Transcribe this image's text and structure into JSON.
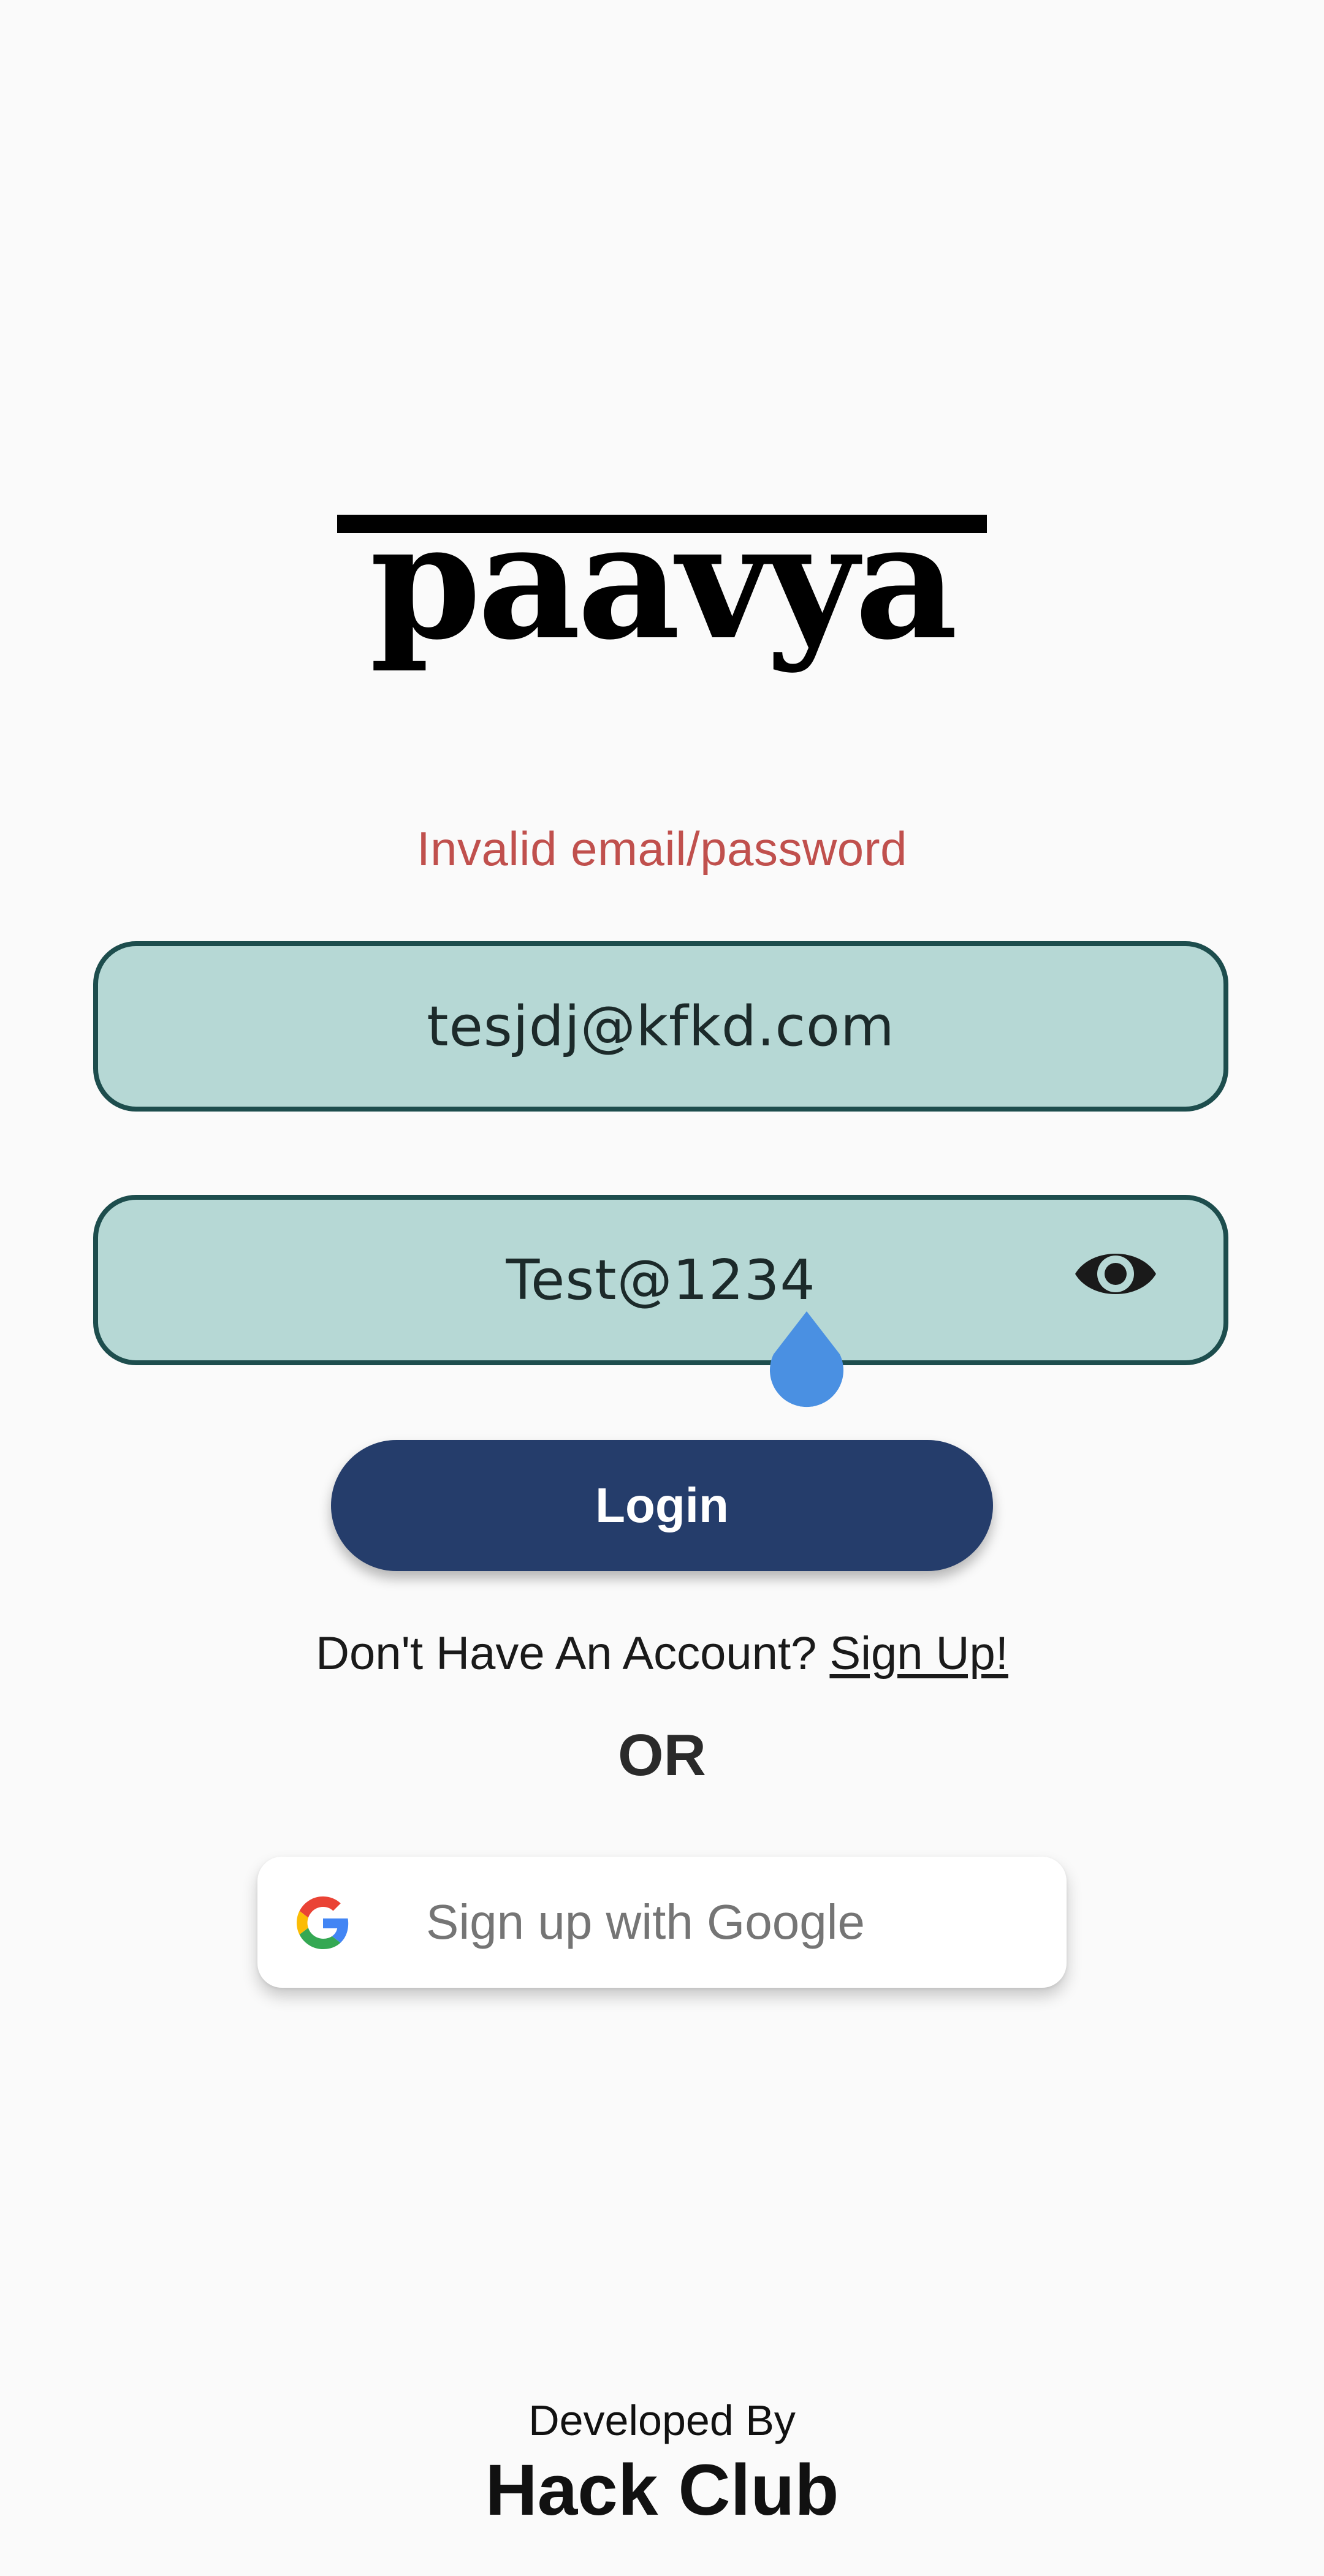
{
  "logo": {
    "text": "paavya"
  },
  "error": {
    "message": "Invalid email/password",
    "color": "#c0504d"
  },
  "email_field": {
    "value": "tesjdj@kfkd.com"
  },
  "password_field": {
    "value": "Test@1234",
    "toggle_icon": "eye-icon"
  },
  "login_button": {
    "label": "Login",
    "color": "#253d6b"
  },
  "signup": {
    "prompt": "Don't Have An Account? ",
    "link": "Sign Up!"
  },
  "divider": {
    "label": "OR"
  },
  "google_button": {
    "label": "Sign up with Google",
    "icon": "google-icon"
  },
  "footer": {
    "developed_by": "Developed By",
    "org": "Hack Club"
  },
  "theme": {
    "field_fill": "#b6d8d5",
    "field_border": "#1d4d4d",
    "background": "#fafafa",
    "caret_handle": "#4a90e2"
  }
}
